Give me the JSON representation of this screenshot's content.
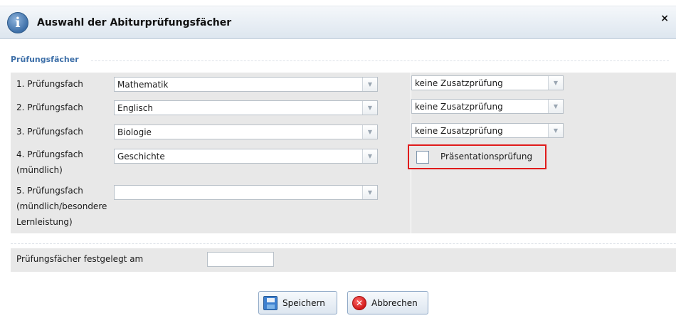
{
  "dialog": {
    "title": "Auswahl der Abiturprüfungsfächer",
    "info_icon": "i",
    "close_icon": "×"
  },
  "section": {
    "legend": "Prüfungsfächer"
  },
  "subjects": [
    {
      "label": "1. Prüfungsfach",
      "value": "Mathematik",
      "extra": "keine Zusatzprüfung"
    },
    {
      "label": "2. Prüfungsfach",
      "value": "Englisch",
      "extra": "keine Zusatzprüfung"
    },
    {
      "label": "3. Prüfungsfach",
      "value": "Biologie",
      "extra": "keine Zusatzprüfung"
    },
    {
      "label_lines": [
        "4. Prüfungsfach",
        "(mündlich)"
      ],
      "value": "Geschichte",
      "checkbox_label": "Präsentationsprüfung",
      "checkbox_checked": false
    },
    {
      "label_lines": [
        "5. Prüfungsfach",
        "(mündlich/besondere",
        "Lernleistung)"
      ],
      "value": ""
    }
  ],
  "date": {
    "label": "Prüfungsfächer festgelegt am",
    "value": ""
  },
  "buttons": {
    "save": "Speichern",
    "cancel": "Abbrechen"
  },
  "icons": {
    "info": "info-icon",
    "close": "close-icon",
    "dropdown": "chevron-down-icon",
    "save": "floppy-disk-icon",
    "cancel": "cancel-icon"
  },
  "colors": {
    "accent": "#3d6fa8",
    "highlight_border": "#e01b1b",
    "row_bg": "#e8e8e8"
  }
}
